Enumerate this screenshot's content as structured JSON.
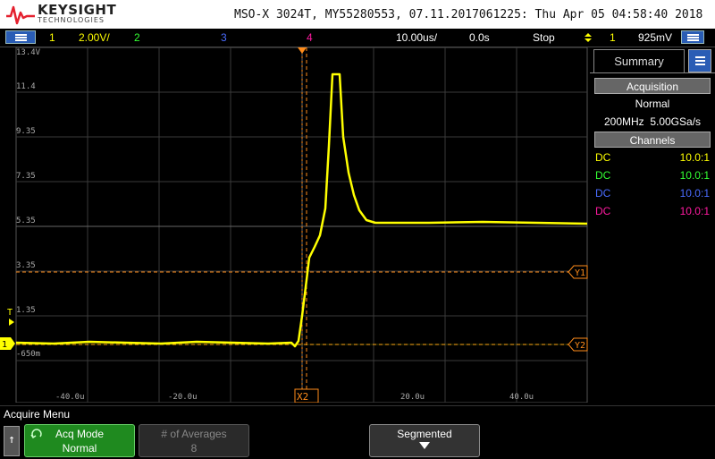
{
  "header": {
    "brand": "KEYSIGHT",
    "brand_sub": "TECHNOLOGIES",
    "title": "MSO-X 3024T, MY55280553, 07.11.2017061225: Thu Apr 05 04:58:40 2018"
  },
  "status": {
    "ch1_num": "1",
    "ch1_scale": "2.00V/",
    "ch2_num": "2",
    "ch3_num": "3",
    "ch4_num": "4",
    "timebase": "10.00us/",
    "delay": "0.0s",
    "run_state": "Stop",
    "trig_source": "1",
    "trig_level": "925mV"
  },
  "plot": {
    "y_labels": [
      "13.4V",
      "11.4",
      "9.35",
      "7.35",
      "5.35",
      "3.35",
      "1.35",
      "-650m"
    ],
    "x_labels": [
      "-40.0u",
      "-20.0u",
      "20.0u",
      "40.0u"
    ],
    "cursors": {
      "y1": "Y1",
      "y2": "Y2",
      "x": "X2"
    },
    "trigger_marker": "T",
    "ground_marker": "1"
  },
  "panel": {
    "tab_label": "Summary",
    "acq_head": "Acquisition",
    "acq_mode": "Normal",
    "acq_rate": "200MHz  5.00GSa/s",
    "channels_head": "Channels",
    "channels": [
      {
        "coupling": "DC",
        "probe": "10.0:1",
        "color": "#ffff00"
      },
      {
        "coupling": "DC",
        "probe": "10.0:1",
        "color": "#33ff33"
      },
      {
        "coupling": "DC",
        "probe": "10.0:1",
        "color": "#4a6cff"
      },
      {
        "coupling": "DC",
        "probe": "10.0:1",
        "color": "#ff1aa0"
      }
    ]
  },
  "softkeys": {
    "menu_title": "Acquire Menu",
    "acq_mode_label": "Acq Mode",
    "acq_mode_value": "Normal",
    "averages_label": "# of Averages",
    "averages_value": "8",
    "segmented_label": "Segmented"
  },
  "colors": {
    "ch1": "#ffff00",
    "ch2": "#33ff33",
    "ch3": "#4a6cff",
    "ch4": "#ff1aa0",
    "cursor": "#ff8c1a",
    "accent": "#2a5db5"
  }
}
